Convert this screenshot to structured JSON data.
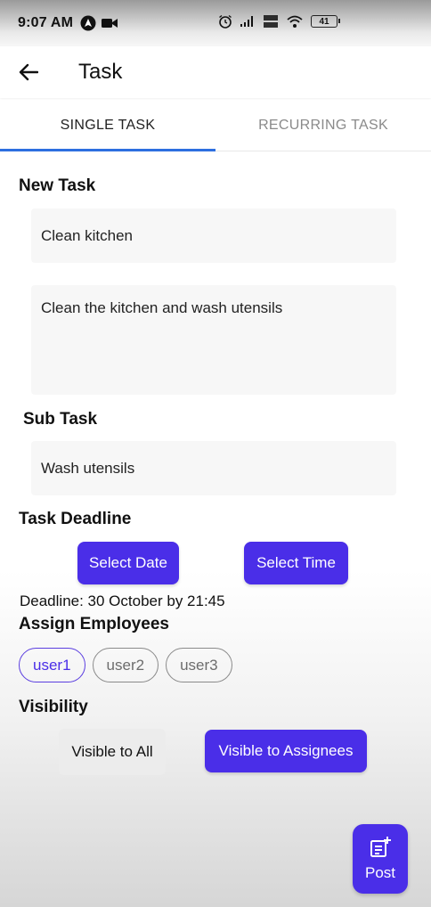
{
  "status_bar": {
    "time": "9:07 AM",
    "battery": "41"
  },
  "app_bar": {
    "title": "Task"
  },
  "tabs": [
    {
      "label": "SINGLE TASK",
      "active": true
    },
    {
      "label": "RECURRING TASK",
      "active": false
    }
  ],
  "new_task": {
    "label": "New Task",
    "title_value": "Clean kitchen",
    "description_value": "Clean the kitchen and wash utensils"
  },
  "sub_task": {
    "label": "Sub Task",
    "value": "Wash utensils"
  },
  "deadline": {
    "label": "Task Deadline",
    "select_date_label": "Select Date",
    "select_time_label": "Select Time",
    "text": "Deadline: 30 October by 21:45"
  },
  "assign": {
    "label": "Assign Employees",
    "users": [
      {
        "name": "user1",
        "selected": true
      },
      {
        "name": "user2",
        "selected": false
      },
      {
        "name": "user3",
        "selected": false
      }
    ]
  },
  "visibility": {
    "label": "Visibility",
    "option_all": "Visible to All",
    "option_assignees": "Visible to Assignees"
  },
  "fab": {
    "label": "Post"
  },
  "colors": {
    "accent": "#4a2ee8",
    "tab_indicator": "#2d6fe0"
  }
}
